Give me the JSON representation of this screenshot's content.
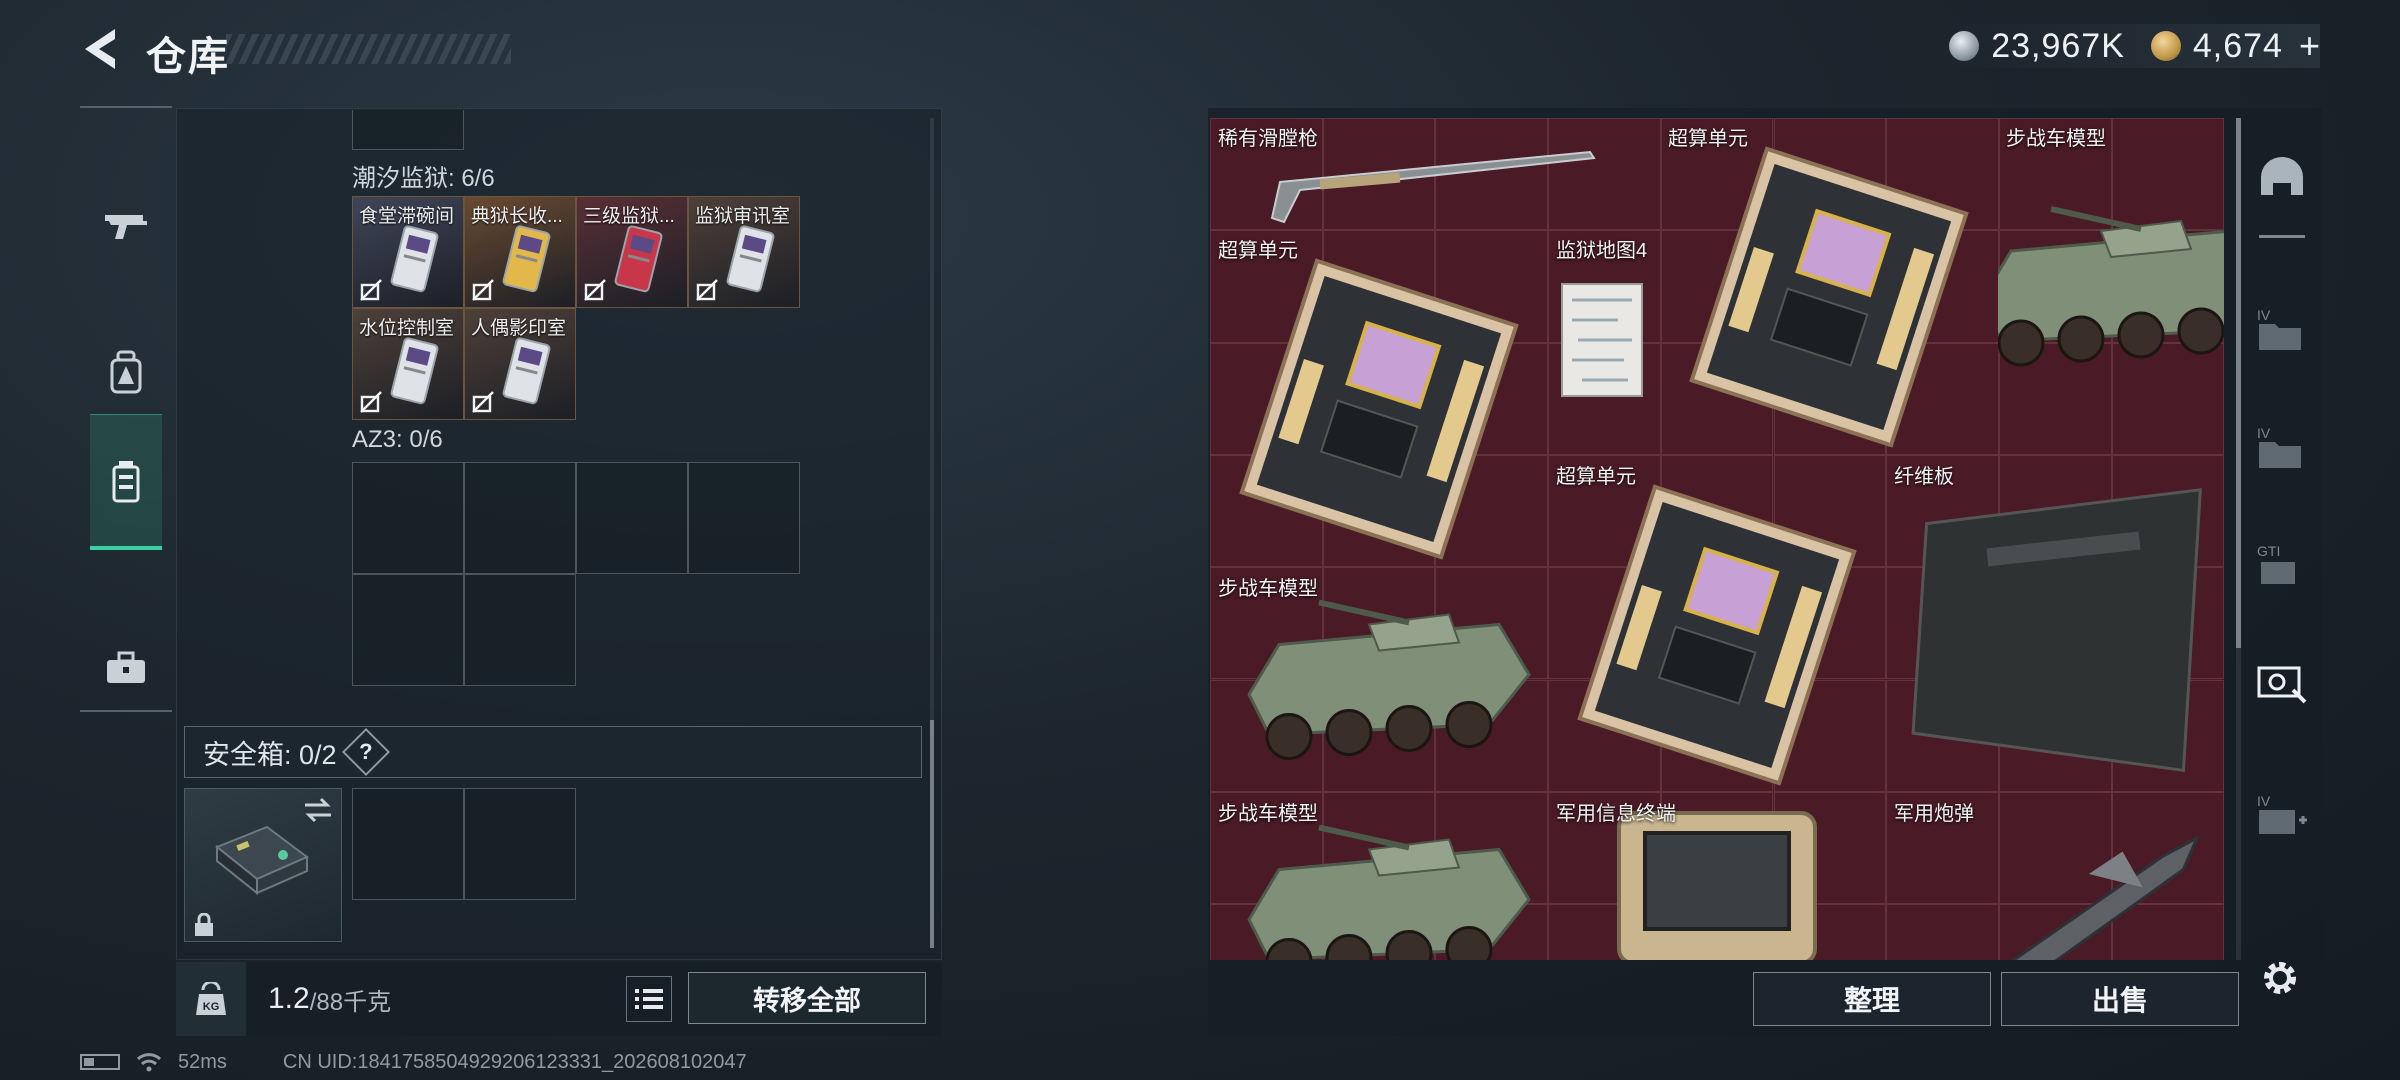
{
  "header": {
    "title": "仓库"
  },
  "currency": {
    "silver_value": "23,967K",
    "gold_value": "4,674",
    "plus_label": "+"
  },
  "left_tabs": [
    {
      "id": "weapons",
      "icon": "gun-icon"
    },
    {
      "id": "gear",
      "icon": "backpack-icon"
    },
    {
      "id": "containers",
      "icon": "container-icon",
      "active": true
    },
    {
      "id": "keys",
      "icon": "briefcase-icon"
    }
  ],
  "left_panel": {
    "section_tide": {
      "label": "潮汐监狱: 6/6",
      "cards": [
        {
          "name": "食堂滞碗间",
          "bg": "#3f4658"
        },
        {
          "name": "典狱长收...",
          "bg": "#6a4a30"
        },
        {
          "name": "三级监狱...",
          "bg": "#5a2f36"
        },
        {
          "name": "监狱审讯室",
          "bg": "#4e4038"
        },
        {
          "name": "水位控制室",
          "bg": "#4e4038"
        },
        {
          "name": "人偶影印室",
          "bg": "#4e4038"
        }
      ]
    },
    "section_az3": {
      "label": "AZ3: 0/6"
    },
    "safe": {
      "label": "安全箱: 0/2",
      "help": "?"
    },
    "weight": {
      "current": "1.2",
      "max": "/88千克"
    },
    "transfer_all": "转移全部"
  },
  "stash_items": [
    {
      "name": "稀有滑膛枪",
      "kind": "musket"
    },
    {
      "name": "超算单元",
      "kind": "chip"
    },
    {
      "name": "步战车模型",
      "kind": "vehicle"
    },
    {
      "name": "超算单元",
      "kind": "chip"
    },
    {
      "name": "监狱地图4",
      "kind": "map"
    },
    {
      "name": "超算单元",
      "kind": "chip"
    },
    {
      "name": "纤维板",
      "kind": "board"
    },
    {
      "name": "步战车模型",
      "kind": "vehicle"
    },
    {
      "name": "步战车模型",
      "kind": "vehicle"
    },
    {
      "name": "军用信息终端",
      "kind": "terminal"
    },
    {
      "name": "军用炮弹",
      "kind": "shell"
    }
  ],
  "buttons": {
    "sort": "整理",
    "sell": "出售"
  },
  "status": {
    "ping": "52ms",
    "uid": "CN UID:1841758504929206123331_202608102047"
  },
  "colors": {
    "accent": "#3cd0a0",
    "grid_bg": "#4a1b26"
  }
}
